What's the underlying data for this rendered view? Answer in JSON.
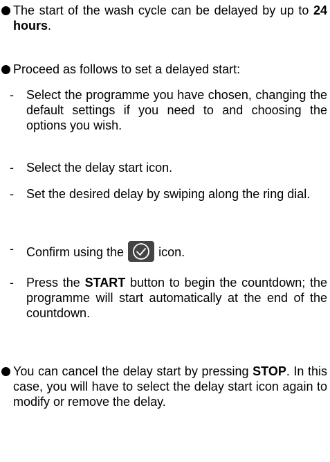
{
  "bullet1": {
    "text_before": "The start of the wash cycle can be delayed by up to ",
    "bold": "24 hours",
    "text_after": "."
  },
  "bullet2": {
    "text": "Proceed as follows to set a delayed start:"
  },
  "step1": {
    "dash": "-",
    "text": "Select the programme you have chosen, changing the default settings if you need to and choosing the options you wish."
  },
  "step2": {
    "dash": "-",
    "text": "Select the delay start icon."
  },
  "step3": {
    "dash": "-",
    "text": "Set the desired delay by swiping along the ring dial."
  },
  "step4": {
    "dash": "-",
    "text_before": "Confirm using the ",
    "icon": "confirm-check-icon",
    "text_after": " icon."
  },
  "step5": {
    "dash": "-",
    "text_before": "Press the ",
    "bold": "START",
    "text_after": " button to begin the countdown; the programme will start automatically at the end of the countdown."
  },
  "bullet3": {
    "text_before": "You can cancel the delay start by pressing ",
    "bold": "STOP",
    "text_after": ". In this case, you will have to select the delay start icon again to modify or remove the delay."
  },
  "colors": {
    "text": "#000000",
    "icon_bg": "#444444",
    "icon_stroke": "#ffffff"
  }
}
